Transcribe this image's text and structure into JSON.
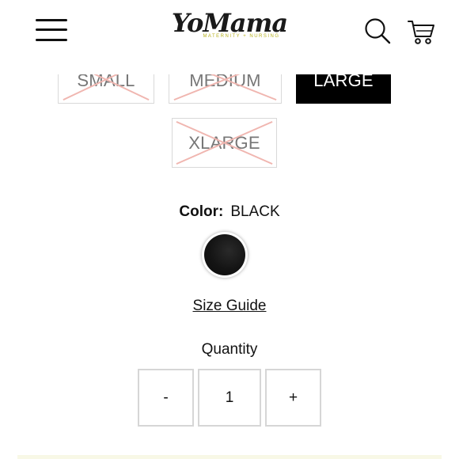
{
  "header": {
    "logo_main": "YoMama",
    "logo_sub": "MATERNITY + NURSING",
    "icons": [
      "menu-icon",
      "search-icon",
      "cart-icon"
    ]
  },
  "sizes": {
    "small": {
      "label": "SMALL",
      "available": false
    },
    "medium": {
      "label": "MEDIUM",
      "available": false
    },
    "large": {
      "label": "LARGE",
      "available": true,
      "selected": true
    },
    "xlarge": {
      "label": "XLARGE",
      "available": false
    }
  },
  "color": {
    "label": "Color:",
    "value": "BLACK",
    "swatch_color": "#111111"
  },
  "size_guide": "Size Guide",
  "quantity": {
    "label": "Quantity",
    "minus": "-",
    "value": "1",
    "plus": "+"
  },
  "colors": {
    "accent": "#000000",
    "logo_sub": "#b7b21e",
    "unavailable_cross": "#f0b6b0"
  }
}
